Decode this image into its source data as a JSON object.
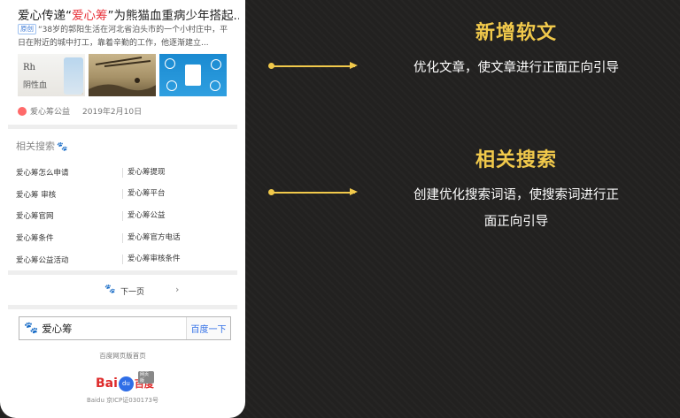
{
  "article": {
    "title_prefix": "爱心传递“",
    "title_highlight": "爱心筹",
    "title_suffix": "”为熊猫血重病少年搭起...",
    "source_tag": "原创",
    "snippet": "“38岁的郭阳生活在河北省泊头市的一个小村庄中，平日在附近的城中打工，靠着辛勤的工作，他逐渐建立...",
    "thumb1_text_a": "Rh",
    "thumb1_text_b": "阴性血",
    "source_name": "爱心筹公益",
    "date": "2019年2月10日"
  },
  "related": {
    "title": "相关搜索",
    "rows": [
      [
        "爱心筹怎么申请",
        "爱心筹提现"
      ],
      [
        "爱心筹 审核",
        "爱心筹平台"
      ],
      [
        "爱心筹官网",
        "爱心筹公益"
      ],
      [
        "爱心筹条件",
        "爱心筹官方电话"
      ],
      [
        "爱心筹公益活动",
        "爱心筹审核条件"
      ]
    ]
  },
  "pager": {
    "next_label": "下一页",
    "arrow": "›"
  },
  "search": {
    "query": "爱心筹",
    "button_label": "百度一下"
  },
  "footer": {
    "homepage_label": "百度网页版首页",
    "logo_bai": "Bai",
    "logo_du": "du",
    "logo_cn": "百度",
    "logo_badge": "网页版",
    "icp": "Baidu 京ICP证030173号"
  },
  "sections": [
    {
      "heading": "新增软文",
      "desc_lines": [
        "优化文章，使文章进行正面正向引导"
      ]
    },
    {
      "heading": "相关搜索",
      "desc_lines": [
        "创建优化搜索词语，使搜索词进行正",
        "面正向引导"
      ]
    }
  ],
  "colors": {
    "accent": "#f1c94b",
    "background": "#222120",
    "highlight": "#e8333b",
    "baidu_blue": "#2f6ee7"
  }
}
